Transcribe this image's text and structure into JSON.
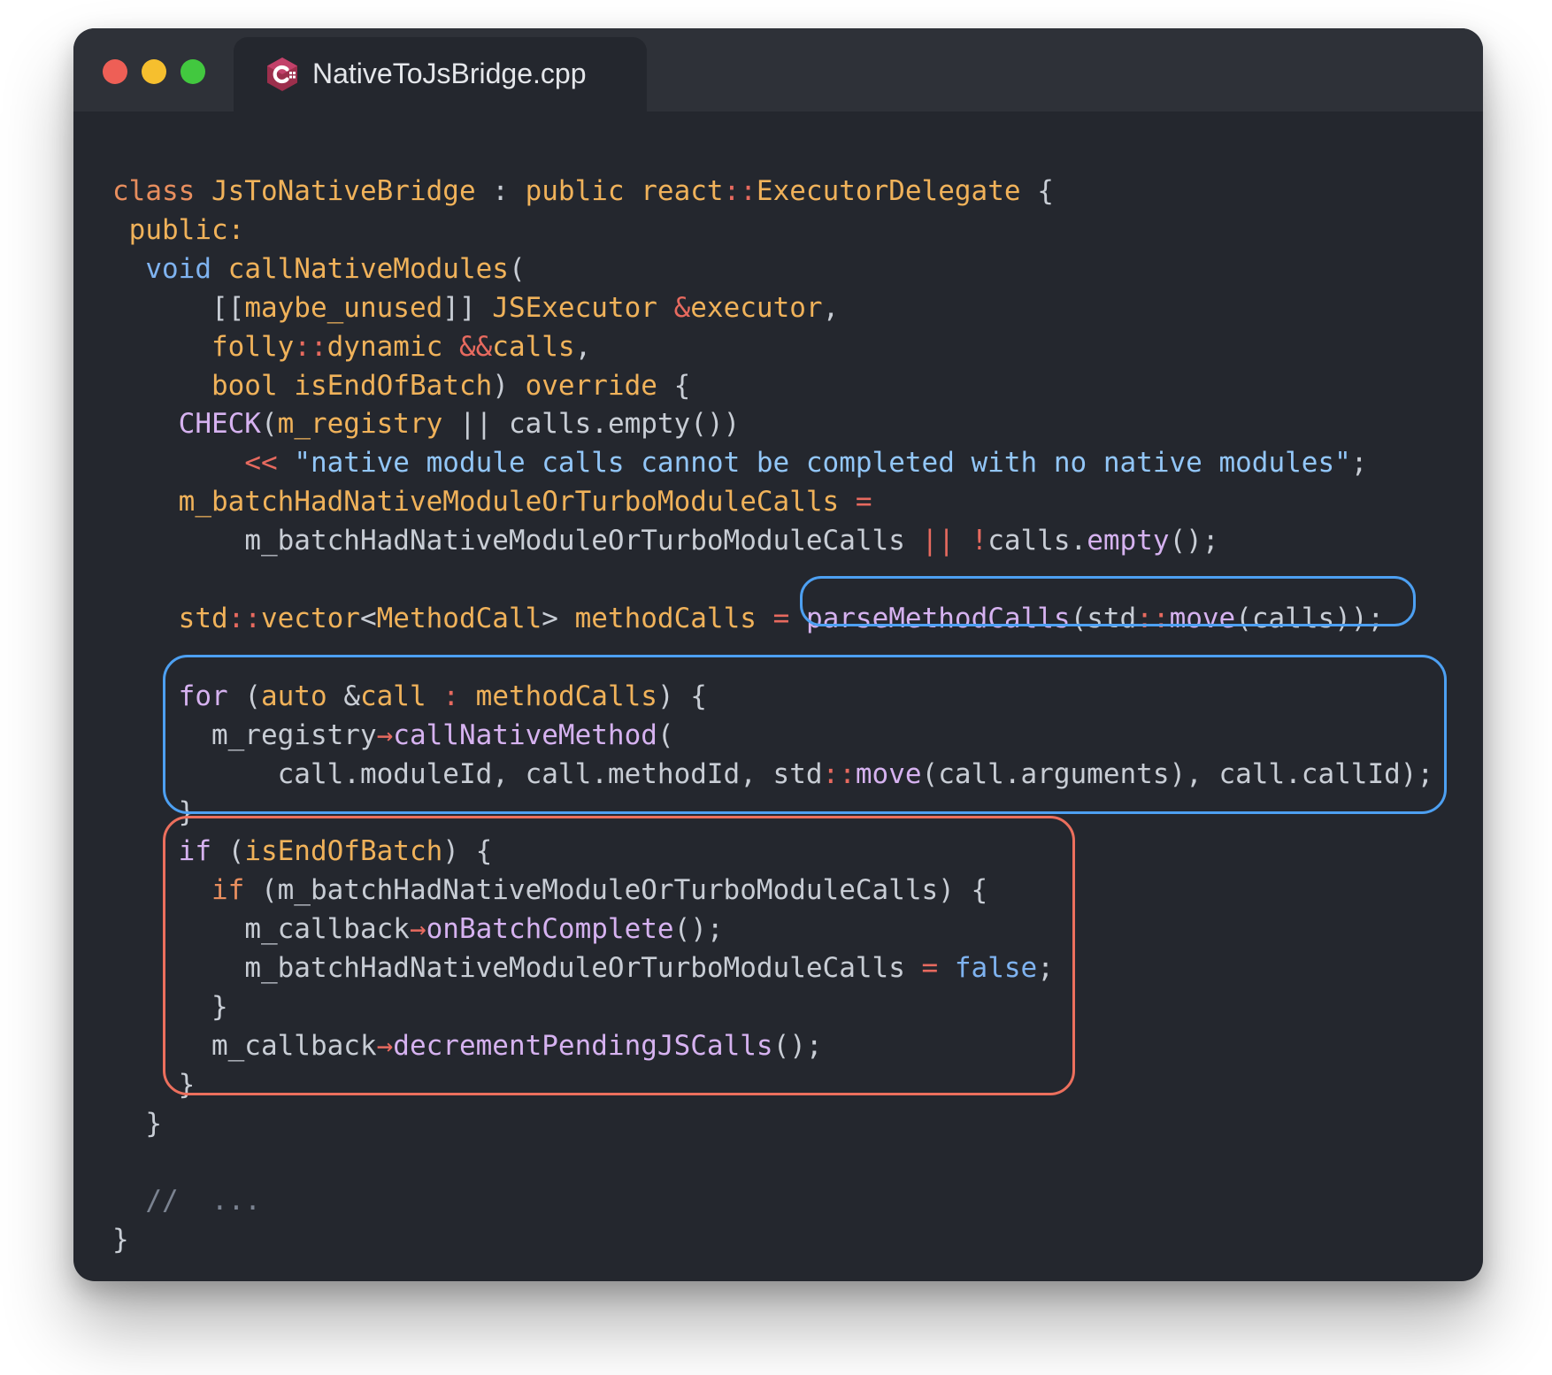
{
  "window": {
    "traffic_lights": [
      {
        "name": "close",
        "color": "#ee5f56"
      },
      {
        "name": "minimize",
        "color": "#f6bf2e"
      },
      {
        "name": "zoom",
        "color": "#42c83f"
      }
    ],
    "tab": {
      "icon": "cpp-file-icon",
      "title": "NativeToJsBridge.cpp"
    }
  },
  "theme": {
    "keyword": "#e88e5e",
    "type": "#f0b25a",
    "function": "#d6b2f0",
    "plain": "#c8cdd5",
    "operator": "#e76a5f",
    "macro": "#d6b2f0",
    "literal": "#7fb3f0",
    "string": "#92c6f8",
    "comment": "#7b8391",
    "highlight_blue": "#4da0f2",
    "highlight_red": "#ec6f5d"
  },
  "editor": {
    "lines": [
      [
        [
          "keyword",
          "class "
        ],
        [
          "type",
          "JsToNativeBridge"
        ],
        [
          "plain",
          " : "
        ],
        [
          "type",
          "public "
        ],
        [
          "type",
          "react"
        ],
        [
          "operator",
          "::"
        ],
        [
          "type",
          "ExecutorDelegate"
        ],
        [
          "plain",
          " {"
        ]
      ],
      [
        [
          "plain",
          " "
        ],
        [
          "type",
          "public:"
        ]
      ],
      [
        [
          "plain",
          "  "
        ],
        [
          "literal",
          "void "
        ],
        [
          "type",
          "callNativeModules"
        ],
        [
          "plain",
          "("
        ]
      ],
      [
        [
          "plain",
          "      [["
        ],
        [
          "type",
          "maybe_unused"
        ],
        [
          "plain",
          "]] "
        ],
        [
          "type",
          "JSExecutor "
        ],
        [
          "operator",
          "&"
        ],
        [
          "type",
          "executor"
        ],
        [
          "plain",
          ","
        ]
      ],
      [
        [
          "plain",
          "      "
        ],
        [
          "type",
          "folly"
        ],
        [
          "operator",
          "::"
        ],
        [
          "type",
          "dynamic "
        ],
        [
          "operator",
          "&&"
        ],
        [
          "type",
          "calls"
        ],
        [
          "plain",
          ","
        ]
      ],
      [
        [
          "plain",
          "      "
        ],
        [
          "type",
          "bool "
        ],
        [
          "type",
          "isEndOfBatch"
        ],
        [
          "plain",
          ") "
        ],
        [
          "type",
          "override"
        ],
        [
          "plain",
          " {"
        ]
      ],
      [
        [
          "plain",
          "    "
        ],
        [
          "macro",
          "CHECK"
        ],
        [
          "plain",
          "("
        ],
        [
          "type",
          "m_registry"
        ],
        [
          "plain",
          " || "
        ],
        [
          "plain",
          "calls"
        ],
        [
          "plain",
          "."
        ],
        [
          "plain",
          "empty"
        ],
        [
          "plain",
          "())"
        ]
      ],
      [
        [
          "plain",
          "        "
        ],
        [
          "operator",
          "<< "
        ],
        [
          "string",
          "\"native module calls cannot be completed with no native modules\""
        ],
        [
          "plain",
          ";"
        ]
      ],
      [
        [
          "plain",
          "    "
        ],
        [
          "type",
          "m_batchHadNativeModuleOrTurboModuleCalls"
        ],
        [
          "plain",
          " "
        ],
        [
          "operator",
          "="
        ]
      ],
      [
        [
          "plain",
          "        "
        ],
        [
          "plain",
          "m_batchHadNativeModuleOrTurboModuleCalls "
        ],
        [
          "operator",
          "|| !"
        ],
        [
          "plain",
          "calls"
        ],
        [
          "plain",
          "."
        ],
        [
          "function",
          "empty"
        ],
        [
          "plain",
          "();"
        ]
      ],
      [],
      [
        [
          "plain",
          "    "
        ],
        [
          "type",
          "std"
        ],
        [
          "operator",
          "::"
        ],
        [
          "type",
          "vector"
        ],
        [
          "plain",
          "<"
        ],
        [
          "type",
          "MethodCall"
        ],
        [
          "plain",
          "> "
        ],
        [
          "type",
          "methodCalls"
        ],
        [
          "plain",
          " "
        ],
        [
          "operator",
          "="
        ],
        [
          "plain",
          " "
        ],
        [
          "function",
          "parseMethodCalls"
        ],
        [
          "plain",
          "("
        ],
        [
          "plain",
          "std"
        ],
        [
          "operator",
          "::"
        ],
        [
          "function",
          "move"
        ],
        [
          "plain",
          "(calls));"
        ]
      ],
      [],
      [
        [
          "plain",
          "    "
        ],
        [
          "function",
          "for"
        ],
        [
          "plain",
          " ("
        ],
        [
          "type",
          "auto "
        ],
        [
          "plain",
          "&"
        ],
        [
          "type",
          "call"
        ],
        [
          "plain",
          " "
        ],
        [
          "operator",
          ":"
        ],
        [
          "plain",
          " "
        ],
        [
          "type",
          "methodCalls"
        ],
        [
          "plain",
          ") {"
        ]
      ],
      [
        [
          "plain",
          "      "
        ],
        [
          "plain",
          "m_registry"
        ],
        [
          "operator",
          "→"
        ],
        [
          "function",
          "callNativeMethod"
        ],
        [
          "plain",
          "("
        ]
      ],
      [
        [
          "plain",
          "          "
        ],
        [
          "plain",
          "call.moduleId, call.methodId, std"
        ],
        [
          "operator",
          "::"
        ],
        [
          "function",
          "move"
        ],
        [
          "plain",
          "(call.arguments), call.callId);"
        ]
      ],
      [
        [
          "plain",
          "    }"
        ]
      ],
      [
        [
          "plain",
          "    "
        ],
        [
          "function",
          "if"
        ],
        [
          "plain",
          " ("
        ],
        [
          "type",
          "isEndOfBatch"
        ],
        [
          "plain",
          ") {"
        ]
      ],
      [
        [
          "plain",
          "      "
        ],
        [
          "keyword",
          "if"
        ],
        [
          "plain",
          " (m_batchHadNativeModuleOrTurboModuleCalls) {"
        ]
      ],
      [
        [
          "plain",
          "        "
        ],
        [
          "plain",
          "m_callback"
        ],
        [
          "operator",
          "→"
        ],
        [
          "function",
          "onBatchComplete"
        ],
        [
          "plain",
          "();"
        ]
      ],
      [
        [
          "plain",
          "        "
        ],
        [
          "plain",
          "m_batchHadNativeModuleOrTurboModuleCalls "
        ],
        [
          "operator",
          "="
        ],
        [
          "plain",
          " "
        ],
        [
          "literal",
          "false"
        ],
        [
          "plain",
          ";"
        ]
      ],
      [
        [
          "plain",
          "      }"
        ]
      ],
      [
        [
          "plain",
          "      "
        ],
        [
          "plain",
          "m_callback"
        ],
        [
          "operator",
          "→"
        ],
        [
          "function",
          "decrementPendingJSCalls"
        ],
        [
          "plain",
          "();"
        ]
      ],
      [
        [
          "plain",
          "    }"
        ]
      ],
      [
        [
          "plain",
          "  }"
        ]
      ],
      [],
      [
        [
          "plain",
          "  "
        ],
        [
          "comment",
          "//  ..."
        ]
      ],
      [
        [
          "plain",
          "}"
        ]
      ]
    ],
    "highlights": [
      {
        "name": "parse-method-calls-highlight",
        "color": "highlight_blue"
      },
      {
        "name": "for-loop-highlight",
        "color": "highlight_blue"
      },
      {
        "name": "end-of-batch-highlight",
        "color": "highlight_red"
      }
    ]
  }
}
